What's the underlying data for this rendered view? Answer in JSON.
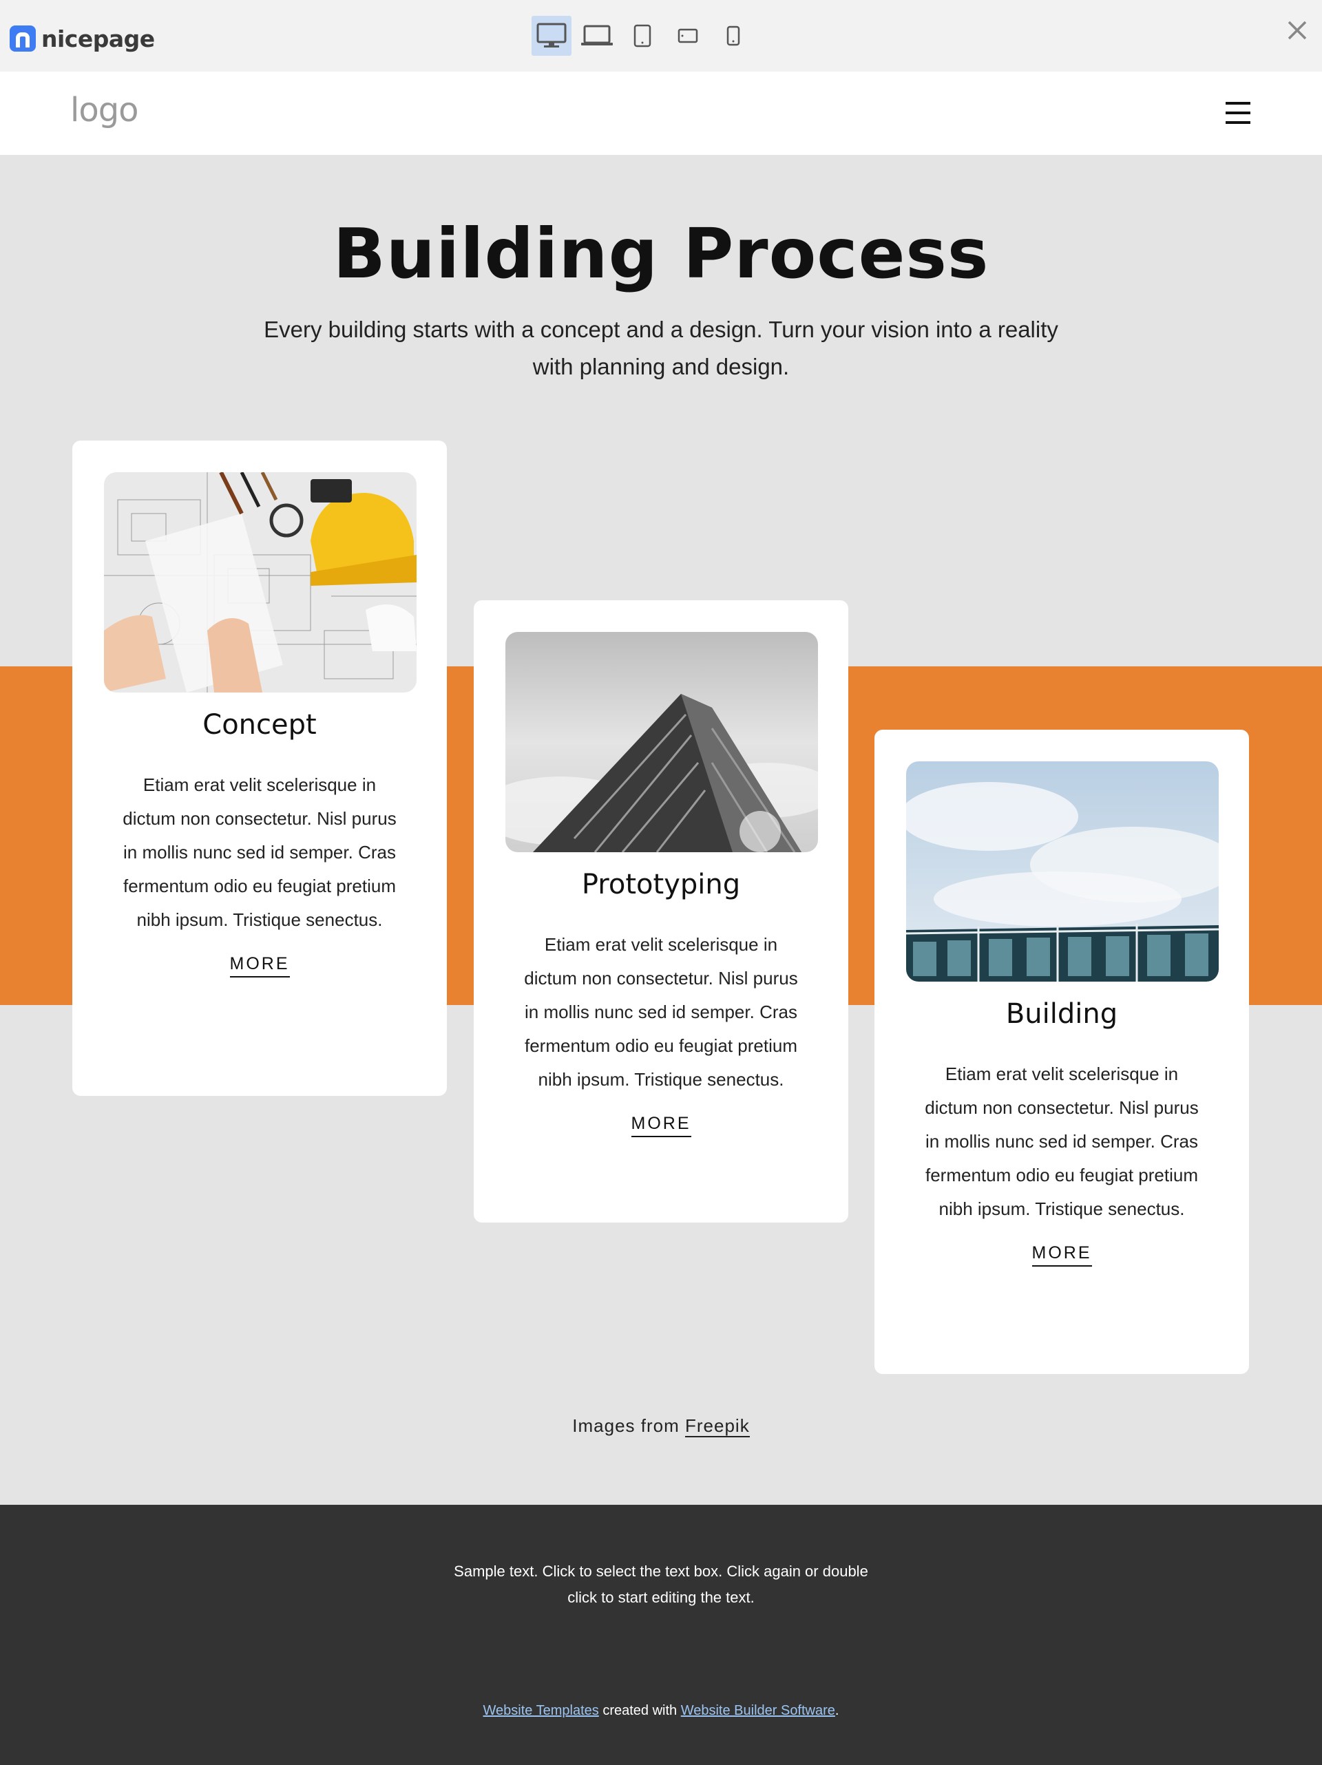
{
  "toolbar": {
    "brand": "nicepage",
    "devices": [
      "desktop-icon",
      "laptop-icon",
      "tablet-icon",
      "tablet-landscape-icon",
      "phone-icon"
    ],
    "active_device": "desktop"
  },
  "header": {
    "logo": "logo"
  },
  "hero": {
    "title": "Building Process",
    "subtitle": "Every building starts with a concept and a design. Turn your vision into a reality with planning and design."
  },
  "cards": [
    {
      "title": "Concept",
      "text": "Etiam erat velit scelerisque in dictum non consectetur. Nisl purus in mollis nunc sed id semper. Cras fermentum odio eu feugiat pretium nibh ipsum. Tristique senectus.",
      "more": "MORE"
    },
    {
      "title": "Prototyping",
      "text": "Etiam erat velit scelerisque in dictum non consectetur. Nisl purus in mollis nunc sed id semper. Cras fermentum odio eu feugiat pretium nibh ipsum. Tristique senectus.",
      "more": "MORE"
    },
    {
      "title": "Building",
      "text": "Etiam erat velit scelerisque in dictum non consectetur. Nisl purus in mollis nunc sed id semper. Cras fermentum odio eu feugiat pretium nibh ipsum. Tristique senectus.",
      "more": "MORE"
    }
  ],
  "credit": {
    "prefix": "Images from",
    "link": "Freepik"
  },
  "footer": {
    "text": "Sample text. Click to select the text box. Click again or double click to start editing the text.",
    "link1": "Website Templates",
    "middle": "created with",
    "link2": "Website Builder Software",
    "suffix": "."
  },
  "colors": {
    "accent": "#e88231",
    "background": "#e4e4e4",
    "footer": "#333333",
    "brand": "#3d7cf3"
  }
}
